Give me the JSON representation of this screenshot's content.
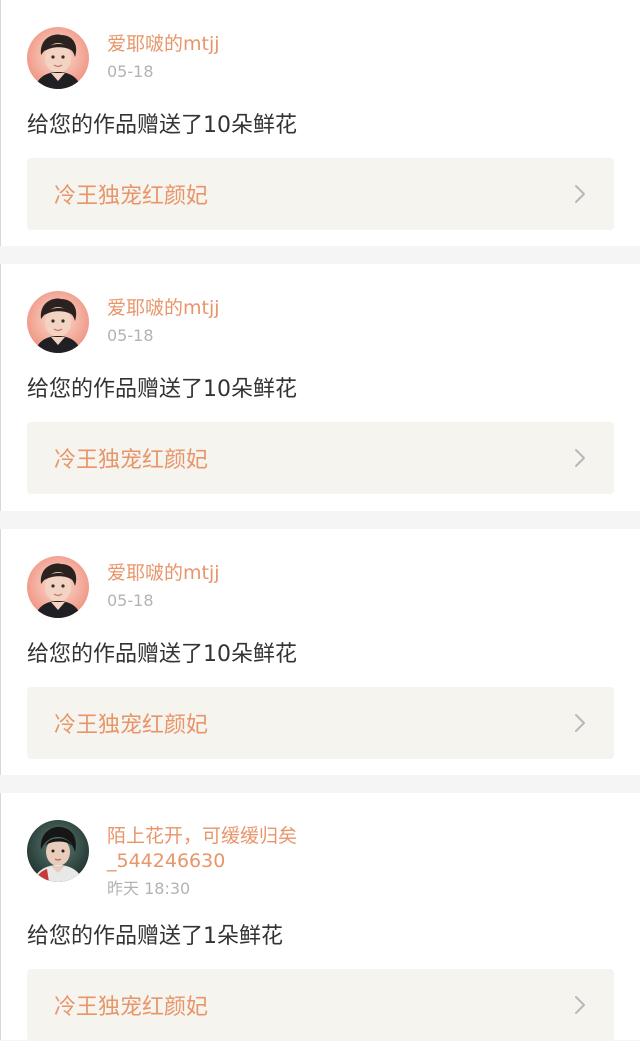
{
  "notifications": [
    {
      "user": "爱耶啵的mtjj",
      "time": "05-18",
      "message": "给您的作品赠送了10朵鲜花",
      "work_title": "冷王独宠红颜妃",
      "avatar": "avatar-portrait-1"
    },
    {
      "user": "爱耶啵的mtjj",
      "time": "05-18",
      "message": "给您的作品赠送了10朵鲜花",
      "work_title": "冷王独宠红颜妃",
      "avatar": "avatar-portrait-1"
    },
    {
      "user": "爱耶啵的mtjj",
      "time": "05-18",
      "message": "给您的作品赠送了10朵鲜花",
      "work_title": "冷王独宠红颜妃",
      "avatar": "avatar-portrait-1"
    },
    {
      "user": "陌上花开，可缓缓归矣_544246630",
      "time": "昨天 18:30",
      "message": "给您的作品赠送了1朵鲜花",
      "work_title": "冷王独宠红颜妃",
      "avatar": "avatar-portrait-2"
    }
  ],
  "icons": {
    "work_link_arrow": "chevron-right-icon"
  },
  "colors": {
    "accent": "#e8956a",
    "message_text": "#333333",
    "timestamp": "#b3b3b3",
    "link_background": "#f6f4ef",
    "divider": "#f5f5f5"
  }
}
